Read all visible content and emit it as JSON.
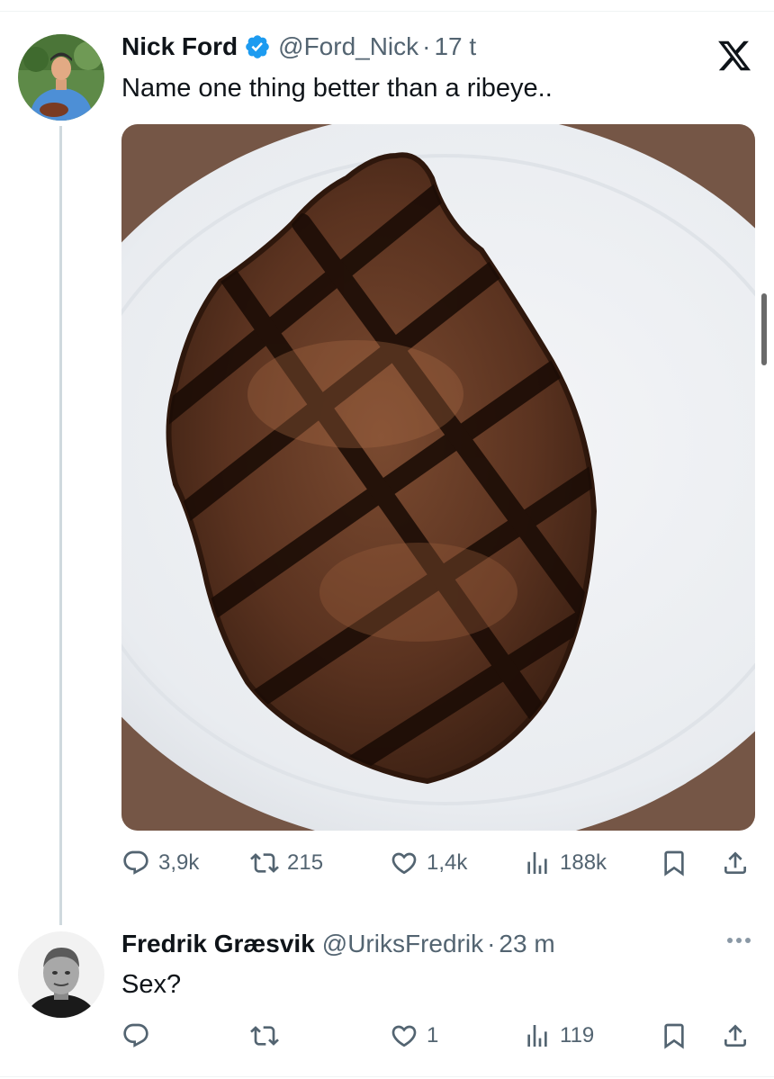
{
  "post": {
    "author_name": "Nick Ford",
    "handle": "@Ford_Nick",
    "separator": "·",
    "time": "17 t",
    "text": "Name one thing better than a ribeye..",
    "counts": {
      "replies": "3,9k",
      "reposts": "215",
      "likes": "1,4k",
      "views": "188k"
    }
  },
  "reply": {
    "author_name": "Fredrik Græsvik",
    "handle": "@UriksFredrik",
    "separator": "·",
    "time": "23 m",
    "text": "Sex?",
    "counts": {
      "replies": "",
      "reposts": "",
      "likes": "1",
      "views": "119"
    }
  },
  "icons": {
    "app": "x-logo-icon",
    "verified": "verified-badge-icon",
    "reply": "reply-icon",
    "repost": "repost-icon",
    "like": "like-icon",
    "views": "views-icon",
    "bookmark": "bookmark-icon",
    "share": "share-icon",
    "more": "more-icon"
  },
  "colors": {
    "text": "#0f1419",
    "secondary": "#536471",
    "verified": "#1d9bf0",
    "thread_line": "#cfd9de"
  }
}
